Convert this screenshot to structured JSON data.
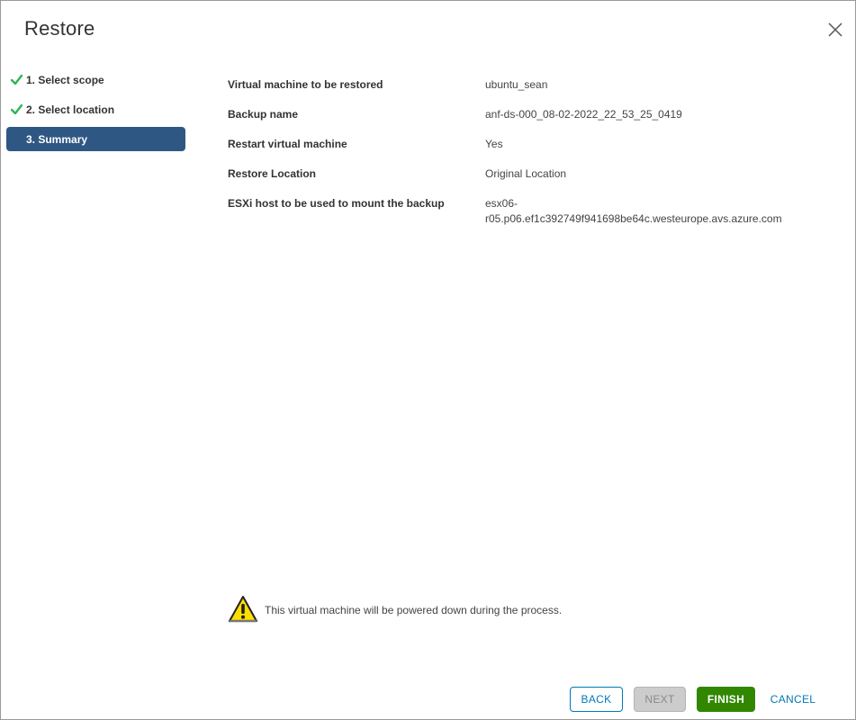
{
  "dialog": {
    "title": "Restore",
    "close_icon": "close-icon"
  },
  "steps": [
    {
      "label": "1. Select scope",
      "status": "complete"
    },
    {
      "label": "2. Select location",
      "status": "complete"
    },
    {
      "label": "3. Summary",
      "status": "active"
    }
  ],
  "summary": {
    "vm": {
      "label": "Virtual machine to be restored",
      "value": "ubuntu_sean"
    },
    "backup": {
      "label": "Backup name",
      "value": "anf-ds-000_08-02-2022_22_53_25_0419"
    },
    "restart": {
      "label": "Restart virtual machine",
      "value": "Yes"
    },
    "location": {
      "label": "Restore Location",
      "value": "Original Location"
    },
    "esxi": {
      "label": "ESXi host to be used to mount the backup",
      "value_line1": "esx06-",
      "value_line2": "r05.p06.ef1c392749f941698be64c.westeurope.avs.azure.com"
    }
  },
  "warning": {
    "icon": "warning-icon",
    "text": "This virtual machine will be powered down during the process."
  },
  "buttons": {
    "back": "BACK",
    "next": "NEXT",
    "finish": "FINISH",
    "cancel": "CANCEL"
  },
  "colors": {
    "active_step": "#2f5783",
    "check": "#2db558",
    "finish": "#318700",
    "link": "#0079b8",
    "warning_fill": "#ffdd00"
  }
}
